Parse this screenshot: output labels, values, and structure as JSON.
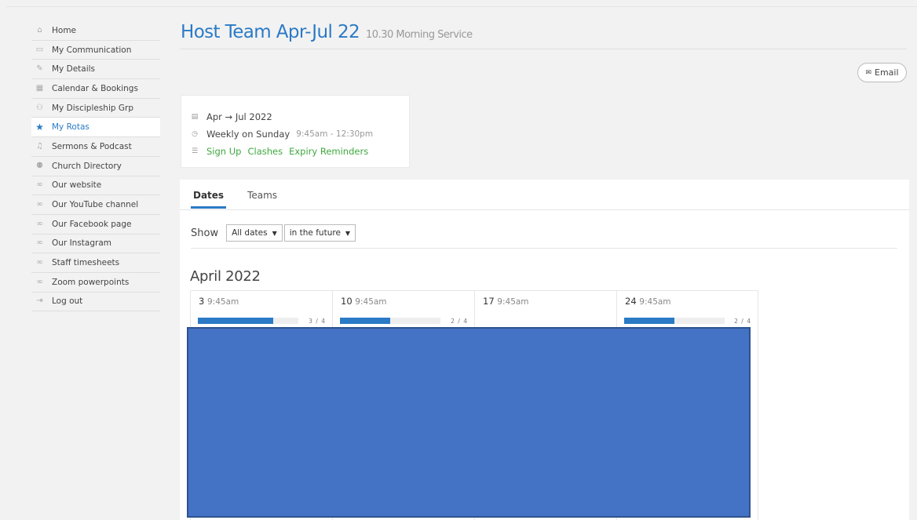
{
  "sidebar": {
    "items": [
      {
        "label": "Home",
        "icon": "⌂",
        "active": false
      },
      {
        "label": "My Communication",
        "icon": "▭",
        "active": false
      },
      {
        "label": "My Details",
        "icon": "✎",
        "active": false
      },
      {
        "label": "Calendar & Bookings",
        "icon": "▦",
        "active": false
      },
      {
        "label": "My Discipleship Grp",
        "icon": "⚇",
        "active": false
      },
      {
        "label": "My Rotas",
        "icon": "★",
        "active": true
      },
      {
        "label": "Sermons & Podcast",
        "icon": "♫",
        "active": false
      },
      {
        "label": "Church Directory",
        "icon": "⚉",
        "active": false
      },
      {
        "label": "Our website",
        "icon": "∞",
        "active": false
      },
      {
        "label": "Our YouTube channel",
        "icon": "∞",
        "active": false
      },
      {
        "label": "Our Facebook page",
        "icon": "∞",
        "active": false
      },
      {
        "label": "Our Instagram",
        "icon": "∞",
        "active": false
      },
      {
        "label": "Staff timesheets",
        "icon": "∞",
        "active": false
      },
      {
        "label": "Zoom powerpoints",
        "icon": "∞",
        "active": false
      },
      {
        "label": "Log out",
        "icon": "⇥",
        "active": false
      }
    ]
  },
  "header": {
    "title": "Host Team Apr-Jul 22",
    "subtitle": "10.30 Morning Service",
    "email_label": "Email",
    "email_icon": "✉"
  },
  "card": {
    "date_icon": "▤",
    "date_range": "Apr → Jul 2022",
    "schedule_icon": "◷",
    "schedule": "Weekly on Sunday",
    "time_range": "9:45am - 12:30pm",
    "links_icon": "☰",
    "links": [
      "Sign Up",
      "Clashes",
      "Expiry Reminders"
    ]
  },
  "tabs": [
    "Dates",
    "Teams"
  ],
  "filters": {
    "show_label": "Show",
    "dates_value": "All dates",
    "time_value": "in the future"
  },
  "month": "April 2022",
  "dates": [
    {
      "day": "3",
      "time": "9:45am",
      "filled": 3,
      "total": 4,
      "count_label": "3 / 4",
      "has_bar": true
    },
    {
      "day": "10",
      "time": "9:45am",
      "filled": 2,
      "total": 4,
      "count_label": "2 / 4",
      "has_bar": true
    },
    {
      "day": "17",
      "time": "9:45am",
      "filled": 0,
      "total": 4,
      "count_label": "",
      "has_bar": false
    },
    {
      "day": "24",
      "time": "9:45am",
      "filled": 2,
      "total": 4,
      "count_label": "2 / 4",
      "has_bar": true
    }
  ],
  "colors": {
    "accent": "#2a7ac6",
    "link_green": "#3fa83f",
    "overlay": "#4472c4"
  }
}
